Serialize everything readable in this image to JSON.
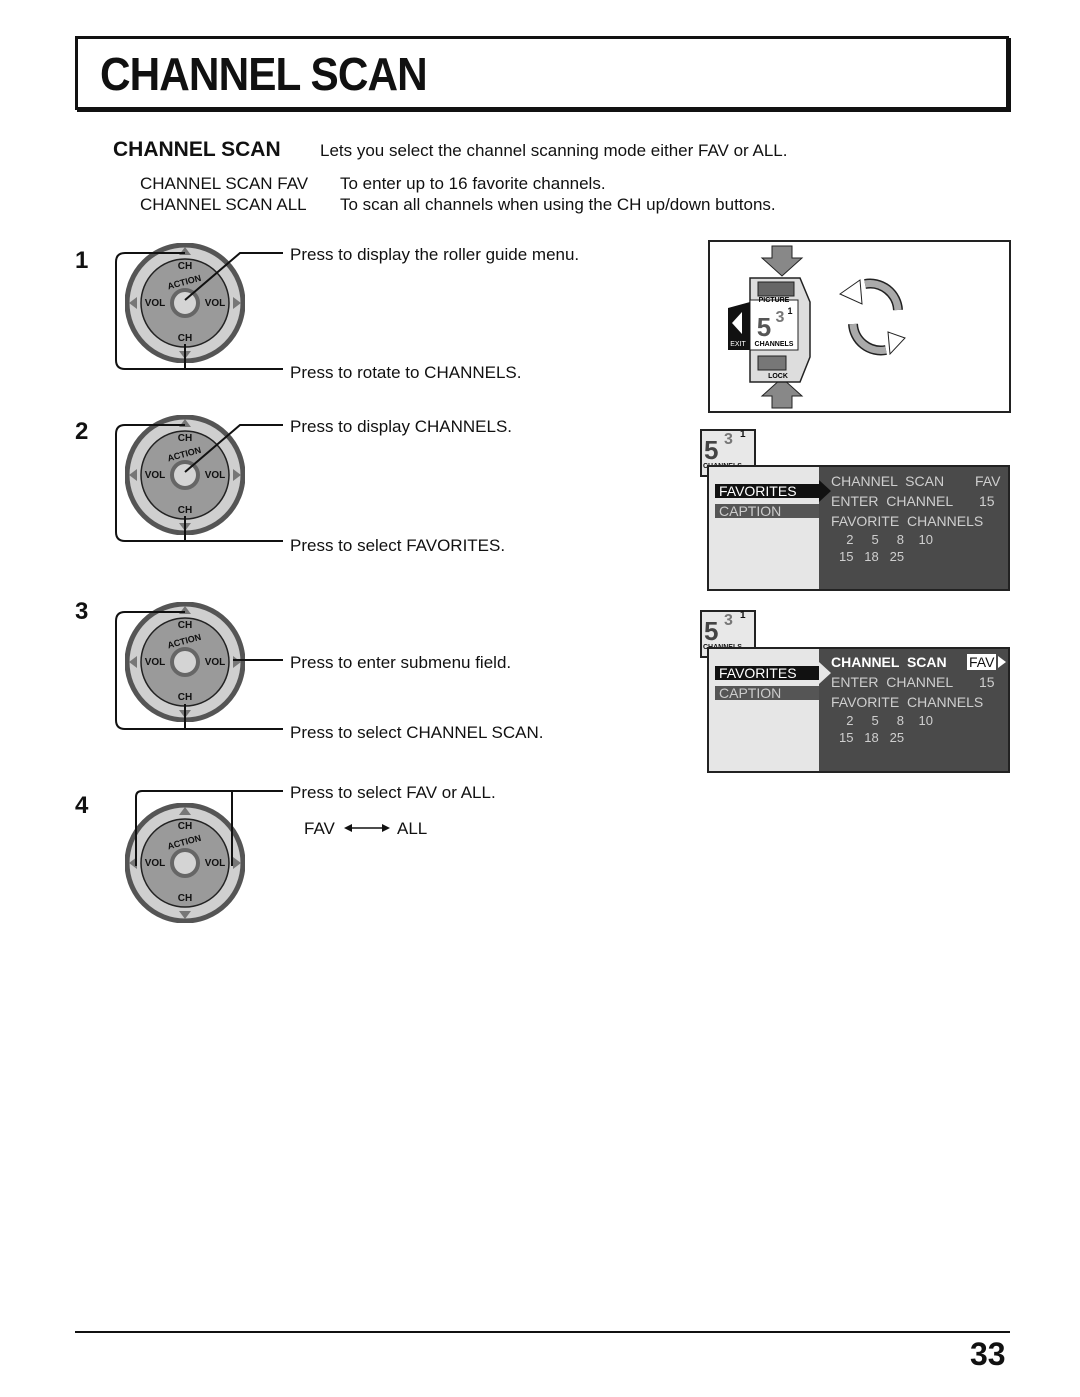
{
  "page": {
    "title": "CHANNEL SCAN",
    "page_number": "33"
  },
  "intro": {
    "heading": "CHANNEL SCAN",
    "description": "Lets you select the channel scanning mode either FAV or ALL.",
    "options": [
      {
        "label": "CHANNEL SCAN FAV",
        "text": "To enter up to 16 favorite channels."
      },
      {
        "label": "CHANNEL SCAN ALL",
        "text": "To scan all channels when using the CH up/down buttons."
      }
    ]
  },
  "remote_labels": {
    "ch": "CH",
    "vol": "VOL",
    "action": "ACTION"
  },
  "steps": [
    {
      "number": "1",
      "captions": [
        "Press to display the roller guide menu.",
        "Press to rotate to CHANNELS."
      ]
    },
    {
      "number": "2",
      "captions": [
        "Press to display CHANNELS.",
        "Press to select FAVORITES."
      ]
    },
    {
      "number": "3",
      "captions": [
        "Press to enter submenu field.",
        "Press to select CHANNEL SCAN."
      ]
    },
    {
      "number": "4",
      "captions": [
        "Press to select FAV or ALL."
      ],
      "toggle": {
        "left": "FAV",
        "right": "ALL"
      }
    }
  ],
  "roller_guide": {
    "items": [
      "PICTURE",
      "CHANNELS",
      "LOCK"
    ],
    "exit_label": "EXIT",
    "icon_digits": {
      "big": "5",
      "mid": "3",
      "small": "1"
    }
  },
  "channels_menu": {
    "badge_label": "CHANNELS",
    "menu_items": [
      "FAVORITES",
      "CAPTION"
    ],
    "channel_scan_label": "CHANNEL  SCAN",
    "channel_scan_value": "FAV",
    "enter_channel_label": "ENTER  CHANNEL",
    "enter_channel_value": "15",
    "favorite_channels_label": "FAVORITE  CHANNELS",
    "favorite_rows": [
      "  2     5     8    10",
      "15   18   25"
    ]
  }
}
